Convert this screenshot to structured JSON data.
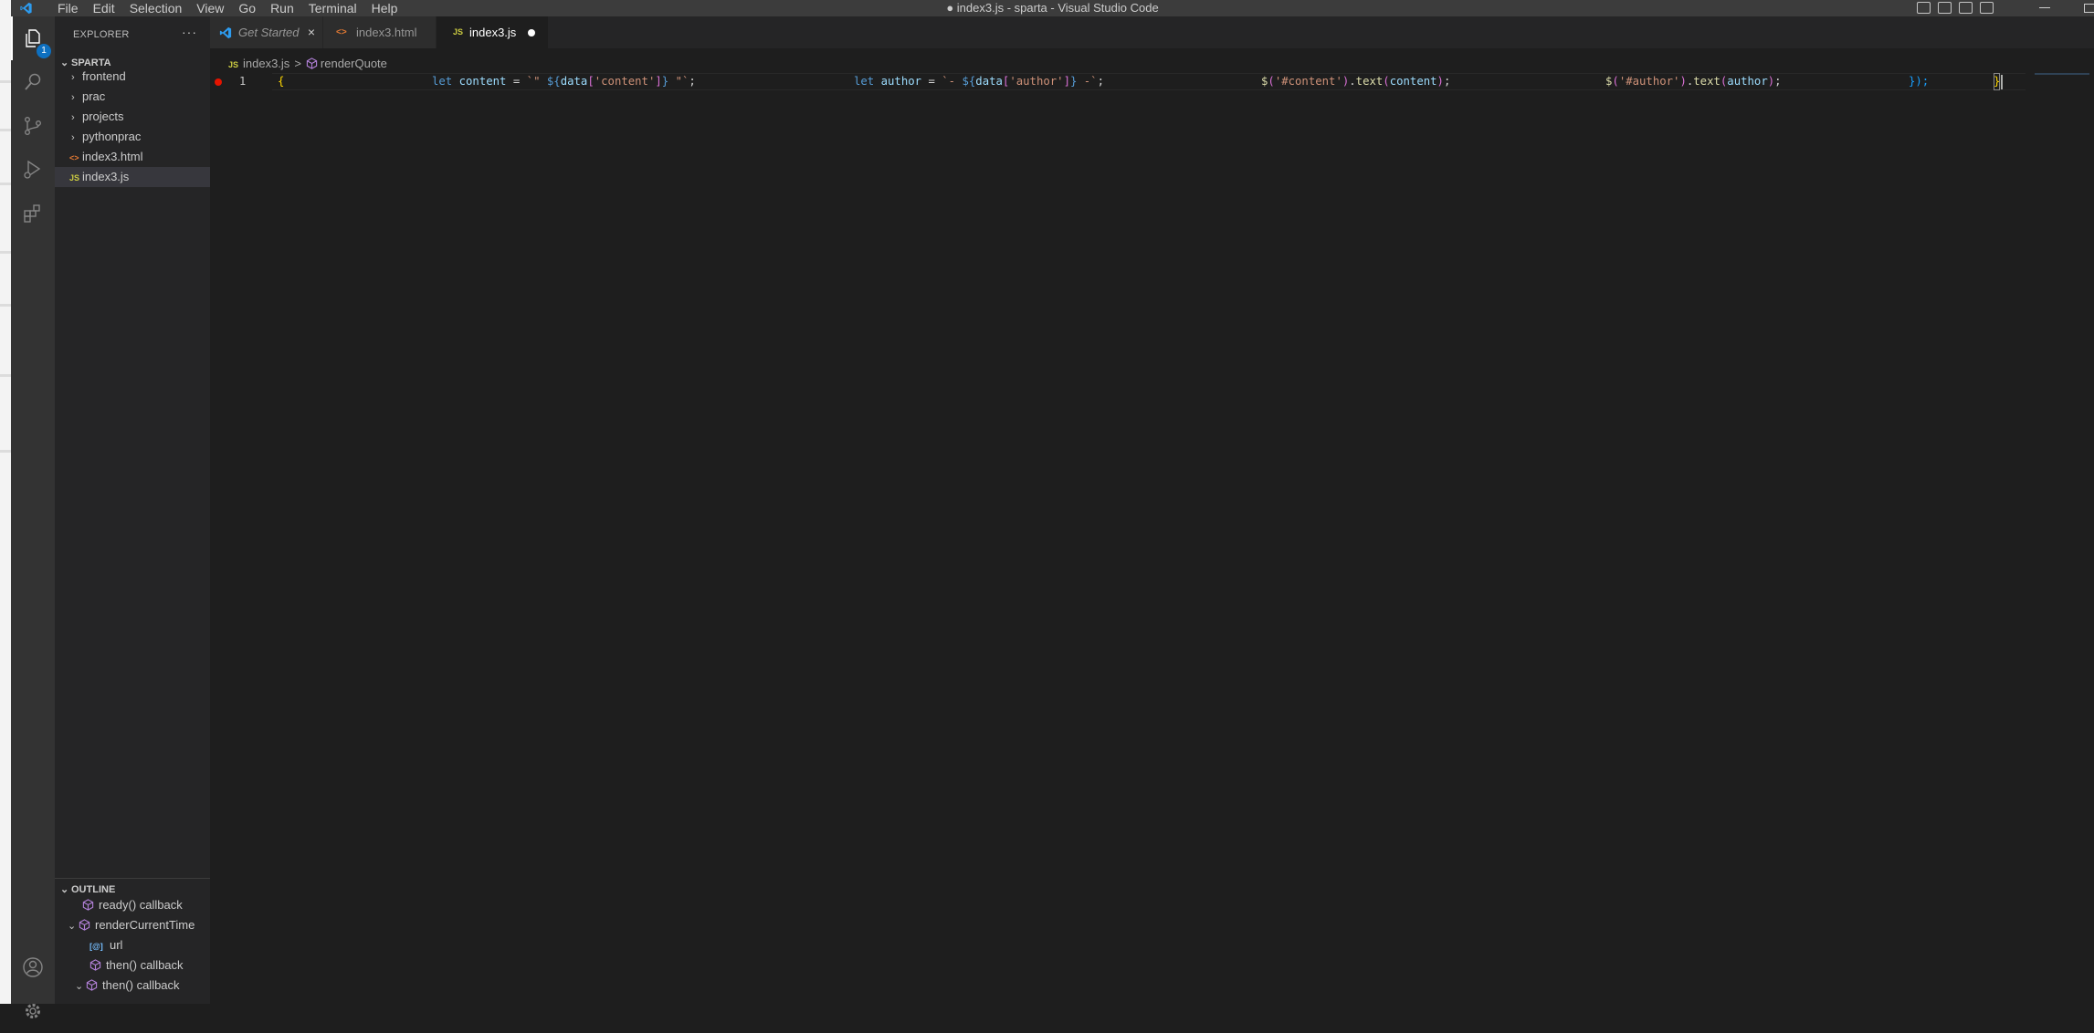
{
  "titlebar": {
    "menu": [
      "File",
      "Edit",
      "Selection",
      "View",
      "Go",
      "Run",
      "Terminal",
      "Help"
    ],
    "title": "● index3.js - sparta - Visual Studio Code"
  },
  "activitybar": {
    "items": [
      "explorer-icon",
      "search-icon",
      "source-control-icon",
      "run-debug-icon",
      "extensions-icon"
    ],
    "explorer_badge": "1",
    "bottom": [
      "account-icon",
      "manage-gear-icon"
    ]
  },
  "sidebar": {
    "title": "EXPLORER",
    "more": "···",
    "workspace": "SPARTA",
    "tree": [
      {
        "label": "frontend",
        "type": "folder"
      },
      {
        "label": "prac",
        "type": "folder"
      },
      {
        "label": "projects",
        "type": "folder"
      },
      {
        "label": "pythonprac",
        "type": "folder"
      },
      {
        "label": "index3.html",
        "type": "html",
        "icon_text": "<>"
      },
      {
        "label": "index3.js",
        "type": "js",
        "icon_text": "JS",
        "selected": true
      }
    ],
    "outline_title": "OUTLINE",
    "outline": [
      {
        "label": "ready() callback",
        "icon": "method-icon"
      },
      {
        "label": "renderCurrentTime",
        "icon": "method-icon",
        "expanded": true
      },
      {
        "label": "url",
        "icon": "variable-icon",
        "icon_text": "[@]"
      },
      {
        "label": "then() callback",
        "icon": "method-icon"
      },
      {
        "label": "then() callback",
        "icon": "method-icon",
        "expanded": true
      }
    ]
  },
  "tabs": [
    {
      "label": "Get Started",
      "close": "×",
      "active": false,
      "italic": true
    },
    {
      "label": "index3.html",
      "icon_text": "<>",
      "active": false
    },
    {
      "label": "index3.js",
      "icon_text": "JS",
      "active": true,
      "modified": true
    }
  ],
  "breadcrumb": {
    "file_icon": "JS",
    "file": "index3.js",
    "separator": ">",
    "symbol": "renderQuote"
  },
  "editor": {
    "line_number": "1",
    "tokens": {
      "open_brace": "{",
      "let1": "let",
      "content_var": "content",
      "eq1": " = ",
      "tmpl1_open": "`\" ",
      "interp1_open": "${",
      "data1": "data",
      "br1_open": "[",
      "str_content": "'content'",
      "br1_close": "]",
      "interp1_close": "}",
      "tmpl1_close": " \"`",
      "semi1": ";",
      "let2": "let",
      "author_var": "author",
      "eq2": " = ",
      "tmpl2_open": "`- ",
      "interp2_open": "${",
      "data2": "data",
      "br2_open": "[",
      "str_author": "'author'",
      "br2_close": "]",
      "interp2_close": "}",
      "tmpl2_close": " -`",
      "semi2": ";",
      "dollar1": "$",
      "paren1_open": "(",
      "str_sel_content": "'#content'",
      "paren1_close": ")",
      "dot1": ".",
      "text1": "text",
      "paren1b_open": "(",
      "arg_content": "content",
      "paren1b_close": ")",
      "semi3": ";",
      "dollar2": "$",
      "paren2_open": "(",
      "str_sel_author": "'#author'",
      "paren2_close": ")",
      "dot2": ".",
      "text2": "text",
      "paren2b_open": "(",
      "arg_author": "author",
      "paren2b_close": ")",
      "semi4": ";",
      "close_all": "});",
      "final_brace": "}"
    }
  }
}
